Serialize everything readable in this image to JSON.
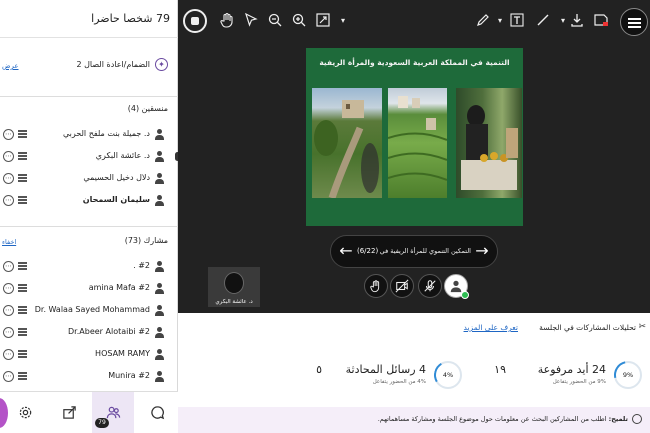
{
  "left_panel": {
    "attendees_header": "79 شخصا حاضرا",
    "group_label": "الضمام/اعادة الصال 2",
    "group_link": "عرض",
    "sections": {
      "moderators": {
        "title": "منسقين (4)"
      },
      "participants": {
        "title": "مشارك (73)",
        "link": "اخفاء"
      }
    },
    "moderators": [
      "د. جميلة بنت ملفح الحربي",
      "د. عائشة البكري",
      "دلال دخيل الحسيمي",
      "سليمان السمحان"
    ],
    "participants": [
      "#2 .",
      "amina Mafa #2",
      "Dr. Walaa Sayed Mohammad",
      "Dr.Abeer Alotaibi #2",
      "HOSAM RAMY",
      "Munira #2"
    ],
    "bottom_bar": {
      "badge": "79"
    }
  },
  "stage": {
    "slide": {
      "title": "التنمية في المملكة العربية السعودية والمرأة الريفية"
    },
    "nav": {
      "title": "التمكين التنموي للمرأة الريفية في إطار الأهدا...",
      "page": "(6/22)"
    },
    "video": {
      "name": "د. عائشة البكري"
    }
  },
  "bottom_panel": {
    "header_title": "تحليلات المشاركات في الجلسة",
    "header_link": "تعرف على المزيد",
    "stats": {
      "hands": {
        "value": "24 أيد مرفوعة",
        "sub": "9% من الحضور يتفاعل",
        "pct": "9%",
        "progress": 0.09
      },
      "messages": {
        "value": "4 رسائل المحادثة",
        "sub": "4% من الحضور يتفاعل",
        "pct": "4%",
        "progress": 0.04
      },
      "num_a": "١٩",
      "num_b": "٥"
    },
    "tip": {
      "label": "تلميح:",
      "text": "اطلب من المشاركين البحث عن معلومات حول موضوع الجلسة ومشاركة مساهماتهم."
    }
  },
  "colors": {
    "accent": "#6a4aa0",
    "link": "#1e66c4",
    "slide_bg": "#1e6a3a",
    "stage_bg": "#222222",
    "progress": "#2f8bd6",
    "ok": "#2dbd52"
  }
}
